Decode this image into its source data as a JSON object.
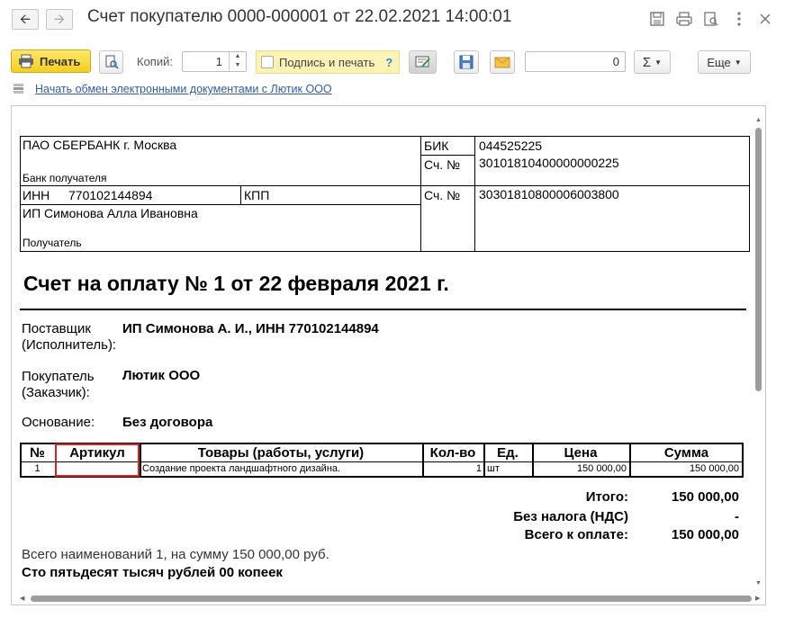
{
  "window": {
    "title": "Счет покупателю 0000-000001 от 22.02.2021 14:00:01",
    "back_icon": "arrow-left",
    "forward_icon": "arrow-right"
  },
  "toolbar": {
    "print_label": "Печать",
    "copies_label": "Копий:",
    "copies_value": "1",
    "sign_label": "Подпись и печать",
    "sign_help": "?",
    "sum_value": "0",
    "sigma_label": "Σ",
    "more_label": "Еще"
  },
  "edo_link": "Начать обмен электронными документами с Лютик ООО",
  "doc": {
    "bank_name": "ПАО СБЕРБАНК г. Москва",
    "bank_caption": "Банк получателя",
    "bik_label": "БИК",
    "bik_value": "044525225",
    "corr_label": "Сч. №",
    "corr_value": "30101810400000000225",
    "inn_label": "ИНН",
    "inn_value": "770102144894",
    "kpp_label": "КПП",
    "account_label": "Сч. №",
    "account_value": "30301810800006003800",
    "recipient_name": "ИП Симонова Алла Ивановна",
    "recipient_caption": "Получатель",
    "heading": "Счет на оплату № 1 от 22 февраля 2021 г.",
    "supplier_label_1": "Поставщик",
    "supplier_label_2": "(Исполнитель):",
    "supplier_value": "ИП Симонова А. И., ИНН 770102144894",
    "buyer_label_1": "Покупатель",
    "buyer_label_2": "(Заказчик):",
    "buyer_value": "Лютик ООО",
    "basis_label": "Основание:",
    "basis_value": "Без договора",
    "table": {
      "headers": [
        "№",
        "Артикул",
        "Товары (работы, услуги)",
        "Кол-во",
        "Ед.",
        "Цена",
        "Сумма"
      ],
      "rows": [
        {
          "num": "1",
          "article": "",
          "name": "Создание проекта ландшафтного дизайна.",
          "qty": "1",
          "unit": "шт",
          "price": "150 000,00",
          "sum": "150 000,00"
        }
      ]
    },
    "total_label": "Итого:",
    "total_value": "150 000,00",
    "vat_label": "Без налога (НДС)",
    "vat_value": "-",
    "pay_label": "Всего к оплате:",
    "pay_value": "150 000,00",
    "summary_line": "Всего наименований 1, на сумму 150 000,00 руб.",
    "amount_words": "Сто пятьдесят тысяч рублей 00 копеек"
  },
  "colors": {
    "print_button": "#f5cf1d",
    "sign_box": "#fdf3b5",
    "link": "#2f5ea6",
    "highlight": "#e02020"
  }
}
